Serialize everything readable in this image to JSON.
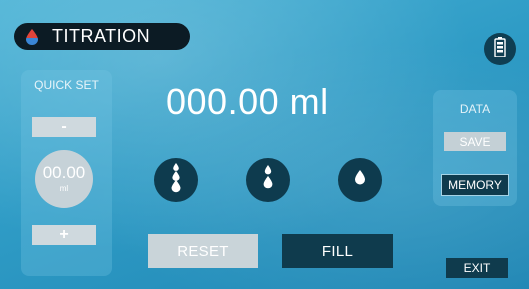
{
  "header": {
    "title": "TITRATION",
    "icon": "drop-icon",
    "battery_icon": "battery-icon"
  },
  "quick_set": {
    "label": "QUICK SET",
    "minus_label": "-",
    "plus_label": "+",
    "value": "00.00",
    "unit": "ml"
  },
  "readout": {
    "value": "000.00 ml"
  },
  "dispense": {
    "buttons": [
      {
        "name": "large-drops",
        "icon": "three-drops-icon"
      },
      {
        "name": "medium-drops",
        "icon": "two-drops-icon"
      },
      {
        "name": "single-drop",
        "icon": "single-drop-icon"
      }
    ]
  },
  "actions": {
    "reset_label": "RESET",
    "fill_label": "FILL"
  },
  "data_panel": {
    "label": "DATA",
    "save_label": "SAVE",
    "memory_label": "MEMORY"
  },
  "exit_label": "EXIT",
  "colors": {
    "background": "#2f9cc6",
    "dark_button": "#0f3b4d",
    "light_button": "#c9d4d9",
    "title_pill": "#0c1b24",
    "drop_accent": "#e0443a"
  }
}
